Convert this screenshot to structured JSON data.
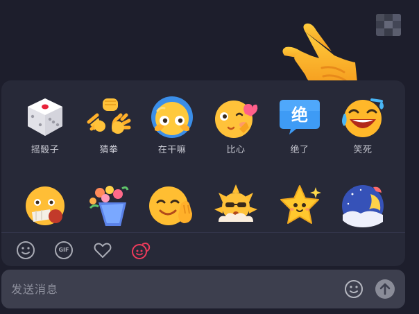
{
  "colors": {
    "background": "#1d1e2c",
    "panel": "#272938",
    "input_bar": "#3d3f4e",
    "label_text": "#c9cad3",
    "placeholder_text": "#8d8f9c",
    "active_tab": "#ee3b5b",
    "inactive_icon": "#a9abb5"
  },
  "emoji_grid": {
    "row1": [
      {
        "label": "摇骰子",
        "icon": "dice-icon"
      },
      {
        "label": "猜拳",
        "icon": "rock-paper-scissors-icon"
      },
      {
        "label": "在干嘛",
        "icon": "peeking-face-icon"
      },
      {
        "label": "比心",
        "icon": "finger-heart-face-icon"
      },
      {
        "label": "绝了",
        "icon": "jue-bubble-icon"
      },
      {
        "label": "笑死",
        "icon": "laughing-tears-face-icon"
      }
    ],
    "row2": [
      {
        "icon": "bandaged-face-icon"
      },
      {
        "icon": "flower-bouquet-icon"
      },
      {
        "icon": "smiling-face-waving-icon"
      },
      {
        "icon": "sun-sunglasses-icon"
      },
      {
        "icon": "smiling-star-icon"
      },
      {
        "icon": "moon-night-icon"
      }
    ]
  },
  "tabs": [
    {
      "name": "smiley-tab",
      "icon": "smiley-icon",
      "active": false
    },
    {
      "name": "gif-tab",
      "icon": "gif-icon",
      "label": "GIF",
      "active": false
    },
    {
      "name": "favorites-tab",
      "icon": "heart-icon",
      "active": false
    },
    {
      "name": "interactive-emoji-tab",
      "icon": "interactive-emoji-icon",
      "active": true
    }
  ],
  "input": {
    "placeholder": "发送消息",
    "value": ""
  }
}
